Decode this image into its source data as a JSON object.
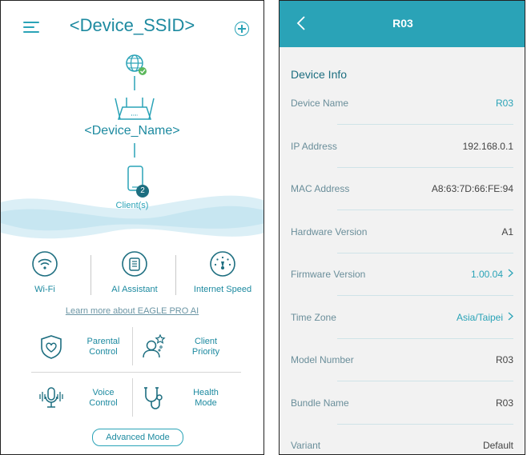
{
  "left": {
    "header": {
      "title": "<Device_SSID>"
    },
    "topology": {
      "device_name": "<Device_Name>",
      "client_count": "2",
      "clients_label": "Client(s)"
    },
    "features": [
      {
        "label": "Wi-Fi",
        "icon": "wifi-icon"
      },
      {
        "label": "AI Assistant",
        "icon": "ai-assistant-icon"
      },
      {
        "label": "Internet Speed",
        "icon": "speed-gauge-icon"
      }
    ],
    "learn_more": "Learn more about EAGLE PRO AI",
    "grid": [
      {
        "label_line1": "Parental",
        "label_line2": "Control",
        "icon": "shield-heart-icon"
      },
      {
        "label_line1": "Client",
        "label_line2": "Priority",
        "icon": "client-priority-icon"
      },
      {
        "label_line1": "Voice",
        "label_line2": "Control",
        "icon": "microphone-icon"
      },
      {
        "label_line1": "Health",
        "label_line2": "Mode",
        "icon": "stethoscope-icon"
      }
    ],
    "advanced_button": "Advanced Mode"
  },
  "right": {
    "header": {
      "title": "R03"
    },
    "section_title": "Device Info",
    "rows": [
      {
        "key": "Device Name",
        "value": "R03",
        "link": true,
        "chevron": false
      },
      {
        "key": "IP Address",
        "value": "192.168.0.1",
        "link": false,
        "chevron": false
      },
      {
        "key": "MAC Address",
        "value": "A8:63:7D:66:FE:94",
        "link": false,
        "chevron": false
      },
      {
        "key": "Hardware Version",
        "value": "A1",
        "link": false,
        "chevron": false
      },
      {
        "key": "Firmware Version",
        "value": "1.00.04",
        "link": true,
        "chevron": true
      },
      {
        "key": "Time Zone",
        "value": "Asia/Taipei",
        "link": true,
        "chevron": true
      },
      {
        "key": "Model Number",
        "value": "R03",
        "link": false,
        "chevron": false
      },
      {
        "key": "Bundle Name",
        "value": "R03",
        "link": false,
        "chevron": false
      },
      {
        "key": "Variant",
        "value": "Default",
        "link": false,
        "chevron": false
      }
    ]
  },
  "colors": {
    "accent": "#2aa3b7",
    "accent_dark": "#1d6e80",
    "status_ok": "#5cb85c"
  }
}
